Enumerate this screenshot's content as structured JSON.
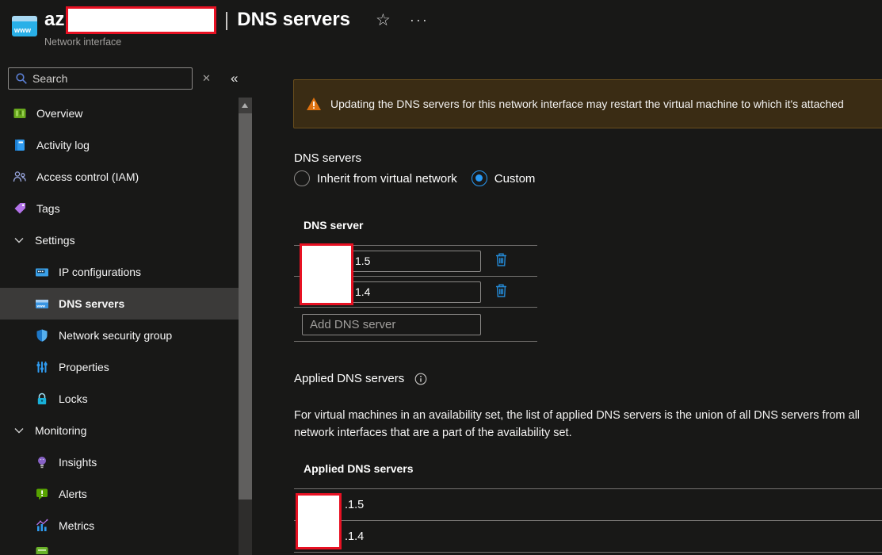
{
  "header": {
    "title_prefix": "az",
    "title_separator": "|",
    "title_page": "DNS servers",
    "subtitle": "Network interface",
    "star_icon": "☆",
    "more_icon": "···",
    "resource_icon_label": "www"
  },
  "sidebar": {
    "search_placeholder": "Search",
    "clear_icon": "✕",
    "collapse_icon": "«",
    "items": [
      {
        "label": "Overview",
        "icon": "overview-icon"
      },
      {
        "label": "Activity log",
        "icon": "activity-log-icon"
      },
      {
        "label": "Access control (IAM)",
        "icon": "access-control-icon"
      },
      {
        "label": "Tags",
        "icon": "tag-icon"
      },
      {
        "label": "Settings",
        "icon": "chevron-down-icon",
        "group": true,
        "expanded": true
      },
      {
        "label": "IP configurations",
        "icon": "ip-configurations-icon"
      },
      {
        "label": "DNS servers",
        "icon": "dns-servers-icon",
        "selected": true
      },
      {
        "label": "Network security group",
        "icon": "shield-icon"
      },
      {
        "label": "Properties",
        "icon": "sliders-icon"
      },
      {
        "label": "Locks",
        "icon": "lock-icon"
      },
      {
        "label": "Monitoring",
        "icon": "chevron-down-icon",
        "group": true,
        "expanded": true
      },
      {
        "label": "Insights",
        "icon": "lightbulb-icon"
      },
      {
        "label": "Alerts",
        "icon": "alert-icon"
      },
      {
        "label": "Metrics",
        "icon": "metrics-icon"
      },
      {
        "label": "",
        "icon": "document-icon",
        "partial": true
      }
    ]
  },
  "main": {
    "warning_banner": "Updating the DNS servers for this network interface may restart the virtual machine to which it's attached",
    "dns_servers": {
      "label": "DNS servers",
      "options": [
        {
          "label": "Inherit from virtual network",
          "selected": false
        },
        {
          "label": "Custom",
          "selected": true
        }
      ]
    },
    "dns_table": {
      "header": "DNS server",
      "rows": [
        {
          "visible_value": "1.5",
          "redacted": true
        },
        {
          "visible_value": "1.4",
          "redacted": true
        }
      ],
      "add_placeholder": "Add DNS server"
    },
    "applied": {
      "heading": "Applied DNS servers",
      "description": "For virtual machines in an availability set, the list of applied DNS servers is the union of all DNS servers from all network interfaces that are a part of the availability set.",
      "table_header": "Applied DNS servers",
      "rows": [
        {
          "visible_value": ".1.5",
          "redacted": true
        },
        {
          "visible_value": ".1.4",
          "redacted": true
        }
      ]
    }
  },
  "colors": {
    "accent_blue": "#2899f5",
    "trash_blue": "#2489d5",
    "warning_orange": "#dd710f",
    "banner_bg": "#3a2c14",
    "redaction_border": "#e81123",
    "selected_item_bg": "#3b3a39"
  }
}
